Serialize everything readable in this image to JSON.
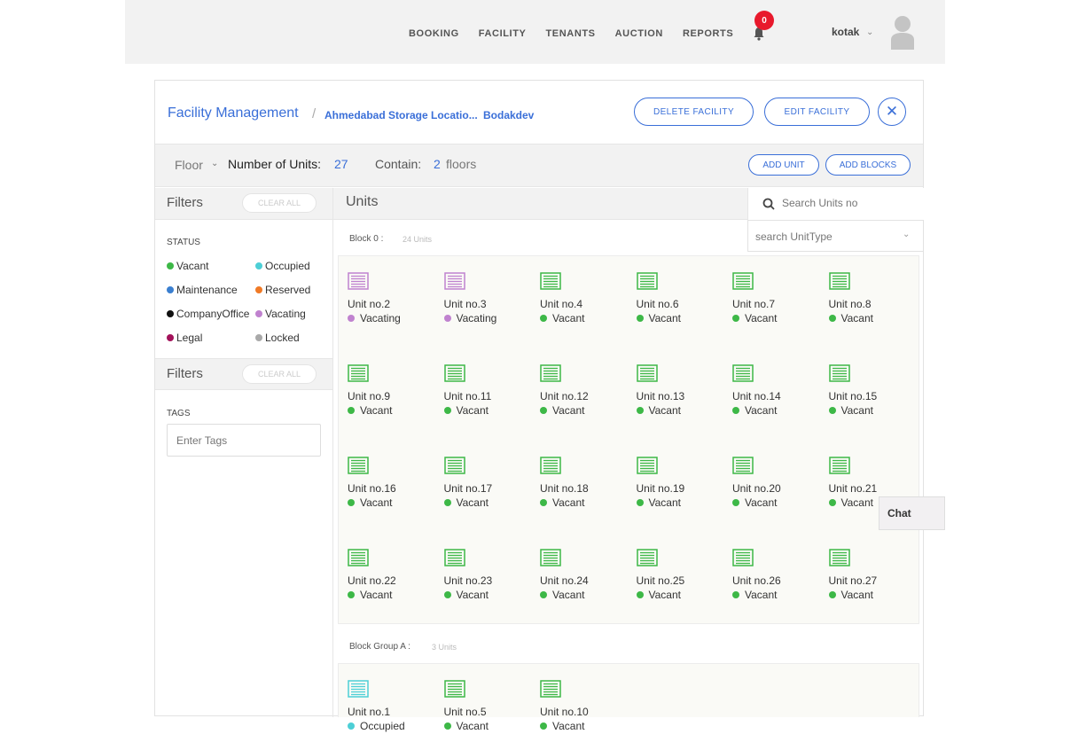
{
  "nav": {
    "items": [
      "BOOKING",
      "FACILITY",
      "TENANTS",
      "AUCTION",
      "REPORTS"
    ],
    "notifications": "0",
    "user": "kotak"
  },
  "header": {
    "title": "Facility Management",
    "location": "Ahmedabad Storage Locatio...",
    "sublocation": "Bodakdev",
    "delete_label": "DELETE FACILITY",
    "edit_label": "EDIT FACILITY"
  },
  "subbar": {
    "floor_label": "Floor",
    "units_label": "Number of Units:",
    "units_value": "27",
    "contain_label": "Contain:",
    "contain_value": "2",
    "contain_unit": "floors",
    "add_unit": "ADD UNIT",
    "add_blocks": "ADD BLOCKS"
  },
  "sidebar": {
    "filters_title": "Filters",
    "clear_all": "CLEAR ALL",
    "status_label": "STATUS",
    "legend": [
      {
        "label": "Vacant",
        "color": "#3db847"
      },
      {
        "label": "Occupied",
        "color": "#4dcfd6"
      },
      {
        "label": "Maintenance",
        "color": "#3a7fd0"
      },
      {
        "label": "Reserved",
        "color": "#f07a26"
      },
      {
        "label": "CompanyOffice",
        "color": "#111111"
      },
      {
        "label": "Vacating",
        "color": "#c082cf"
      },
      {
        "label": "Legal",
        "color": "#a3125a"
      },
      {
        "label": "Locked",
        "color": "#a9a9a9"
      }
    ],
    "filters2_title": "Filters",
    "clear_all2": "CLEAR ALL",
    "tags_label": "TAGS",
    "tags_placeholder": "Enter Tags"
  },
  "main": {
    "title": "Units",
    "search_placeholder": "Search Units no",
    "type_placeholder": "search UnitType"
  },
  "blocks": [
    {
      "name": "Block 0 :",
      "count": "24 Units",
      "units": [
        {
          "name": "Unit no.2",
          "status": "Vacating"
        },
        {
          "name": "Unit no.3",
          "status": "Vacating"
        },
        {
          "name": "Unit no.4",
          "status": "Vacant"
        },
        {
          "name": "Unit no.6",
          "status": "Vacant"
        },
        {
          "name": "Unit no.7",
          "status": "Vacant"
        },
        {
          "name": "Unit no.8",
          "status": "Vacant"
        },
        {
          "name": "Unit no.9",
          "status": "Vacant"
        },
        {
          "name": "Unit no.11",
          "status": "Vacant"
        },
        {
          "name": "Unit no.12",
          "status": "Vacant"
        },
        {
          "name": "Unit no.13",
          "status": "Vacant"
        },
        {
          "name": "Unit no.14",
          "status": "Vacant"
        },
        {
          "name": "Unit no.15",
          "status": "Vacant"
        },
        {
          "name": "Unit no.16",
          "status": "Vacant"
        },
        {
          "name": "Unit no.17",
          "status": "Vacant"
        },
        {
          "name": "Unit no.18",
          "status": "Vacant"
        },
        {
          "name": "Unit no.19",
          "status": "Vacant"
        },
        {
          "name": "Unit no.20",
          "status": "Vacant"
        },
        {
          "name": "Unit no.21",
          "status": "Vacant"
        },
        {
          "name": "Unit no.22",
          "status": "Vacant"
        },
        {
          "name": "Unit no.23",
          "status": "Vacant"
        },
        {
          "name": "Unit no.24",
          "status": "Vacant"
        },
        {
          "name": "Unit no.25",
          "status": "Vacant"
        },
        {
          "name": "Unit no.26",
          "status": "Vacant"
        },
        {
          "name": "Unit no.27",
          "status": "Vacant"
        }
      ]
    },
    {
      "name": "Block Group A :",
      "count": "3 Units",
      "units": [
        {
          "name": "Unit no.1",
          "status": "Occupied"
        },
        {
          "name": "Unit no.5",
          "status": "Vacant"
        },
        {
          "name": "Unit no.10",
          "status": "Vacant"
        }
      ]
    }
  ],
  "chat": "Chat"
}
